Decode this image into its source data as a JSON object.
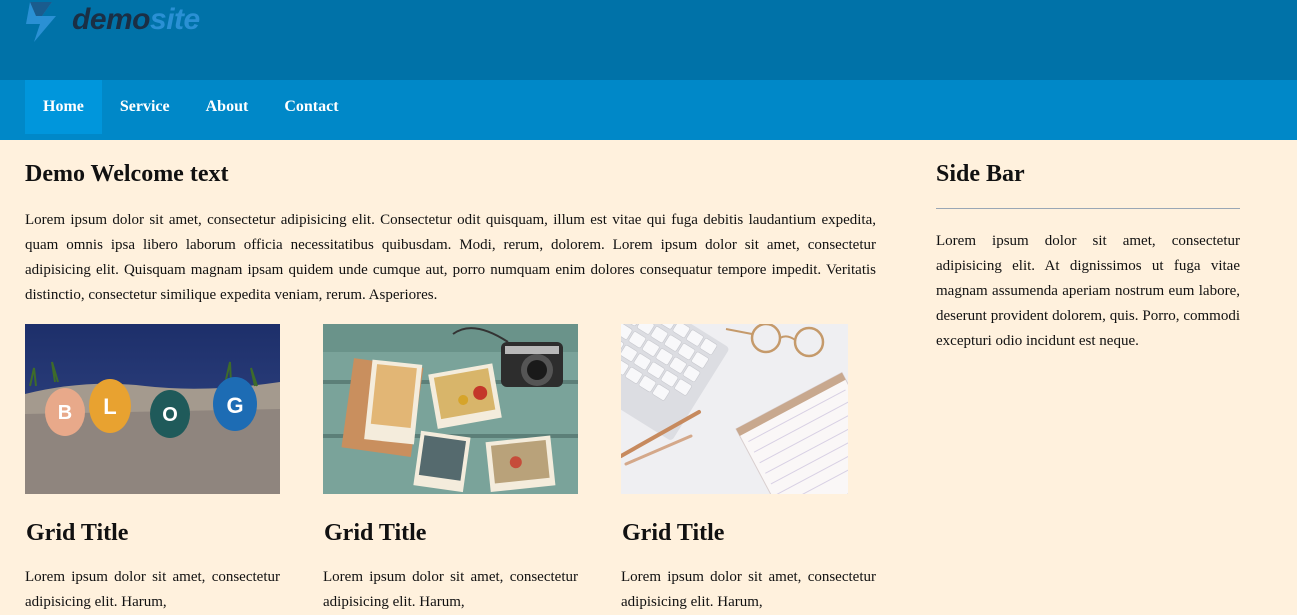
{
  "brand": {
    "logo_demo": "demo",
    "logo_site": "site"
  },
  "nav": {
    "items": [
      {
        "label": "Home",
        "active": true
      },
      {
        "label": "Service"
      },
      {
        "label": "About"
      },
      {
        "label": "Contact"
      }
    ]
  },
  "main": {
    "title": "Demo Welcome text",
    "intro": "Lorem ipsum dolor sit amet, consectetur adipisicing elit. Consectetur odit quisquam, illum est vitae qui fuga debitis laudantium expedita, quam omnis ipsa libero laborum officia necessitatibus quibusdam. Modi, rerum, dolorem. Lorem ipsum dolor sit amet, consectetur adipisicing elit. Quisquam magnam ipsam quidem unde cumque aut, porro numquam enim dolores consequatur tempore impedit. Veritatis distinctio, consectetur similique expedita veniam, rerum. Asperiores.",
    "grid": [
      {
        "title": "Grid Title",
        "text": "Lorem ipsum dolor sit amet, consectetur adipisicing elit. Harum,",
        "image": "blog-stones"
      },
      {
        "title": "Grid Title",
        "text": "Lorem ipsum dolor sit amet, consectetur adipisicing elit. Harum,",
        "image": "photos-camera"
      },
      {
        "title": "Grid Title",
        "text": "Lorem ipsum dolor sit amet, consectetur adipisicing elit. Harum,",
        "image": "desk-keyboard"
      }
    ]
  },
  "sidebar": {
    "title": "Side Bar",
    "text": "Lorem ipsum dolor sit amet, consectetur adipisicing elit. At dignissimos ut fuga vitae magnam assumenda aperiam nostrum eum labore, deserunt provident dolorem, quis. Porro, commodi excepturi odio incidunt est neque."
  },
  "colors": {
    "header": "#0072a8",
    "nav": "#0088c8",
    "nav_active": "#0096dc",
    "page_bg": "#fff1dd"
  }
}
